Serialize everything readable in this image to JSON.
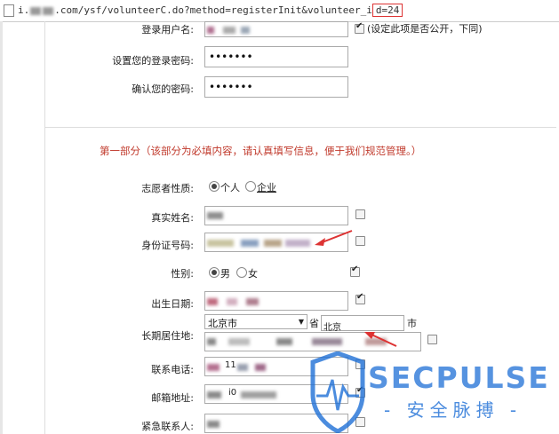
{
  "url": {
    "prefix": "i.",
    "middle": ".com/ysf/volunteerC.do?method=registerInit&volunteer_i",
    "highlight": "d=24"
  },
  "account": {
    "username_label": "登录用户名:",
    "username_note": "(设定此项是否公开，下同)",
    "password_label": "设置您的登录密码:",
    "password_dots": "•••••••",
    "confirm_label": "确认您的密码:",
    "confirm_dots": "•••••••"
  },
  "section": {
    "title": "第一部分（该部分为必填内容，请认真填写信息，便于我们规范管理。）"
  },
  "fields": {
    "nature_label": "志愿者性质:",
    "nature_opt1": "个人",
    "nature_opt2": "企业",
    "realname_label": "真实姓名:",
    "idcard_label": "身份证号码:",
    "gender_label": "性别:",
    "gender_opt1": "男",
    "gender_opt2": "女",
    "birth_label": "出生日期:",
    "residence_label": "长期居住地:",
    "province_value": "北京市",
    "province_suffix": "省",
    "city_value": "北京",
    "city_suffix": "市",
    "phone_label": "联系电话:",
    "phone_partial": "11",
    "email_label": "邮箱地址:",
    "email_partial": "i0",
    "emergency_label": "紧急联系人:"
  },
  "watermark": {
    "brand": "SECPULSE",
    "subtitle": "- 安全脉搏 -"
  },
  "colors": {
    "accent_red": "#c0392b",
    "watermark_blue": "#1e6fd6"
  }
}
